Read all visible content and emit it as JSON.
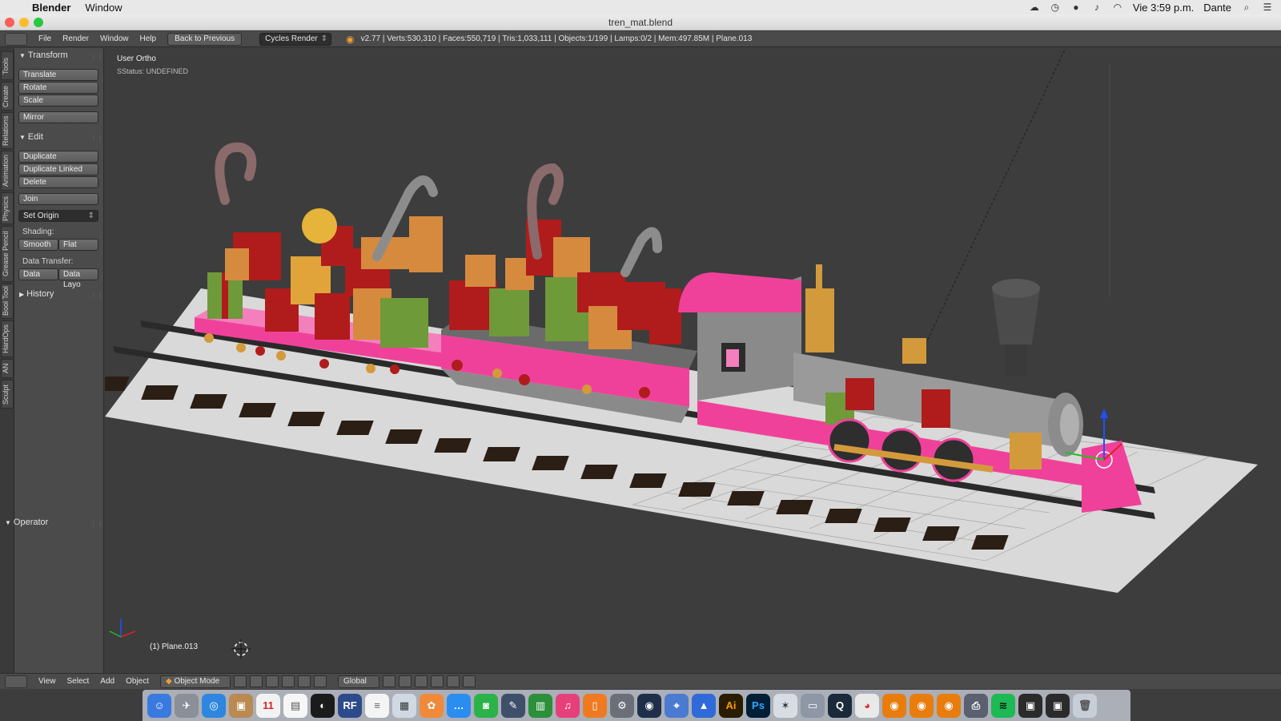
{
  "mac_menubar": {
    "app_name": "Blender",
    "menus": [
      "Window"
    ],
    "clock": "Vie 3:59 p.m.",
    "user": "Dante"
  },
  "window": {
    "title": "tren_mat.blend"
  },
  "info_header": {
    "menus": [
      "File",
      "Render",
      "Window",
      "Help"
    ],
    "back_button": "Back to Previous",
    "render_engine": "Cycles Render",
    "stats": "v2.77 | Verts:530,310 | Faces:550,719 | Tris:1,033,111 | Objects:1/199 | Lamps:0/2 | Mem:497.85M | Plane.013"
  },
  "vertical_tabs": [
    "Tools",
    "Create",
    "Relations",
    "Animation",
    "Physics",
    "Grease Pencil",
    "Bool Tool",
    "HardOps",
    "AN",
    "Sculpt"
  ],
  "toolshelf": {
    "transform": {
      "title": "Transform",
      "buttons": [
        "Translate",
        "Rotate",
        "Scale",
        "Mirror"
      ]
    },
    "edit": {
      "title": "Edit",
      "buttons": [
        "Duplicate",
        "Duplicate Linked",
        "Delete",
        "Join"
      ],
      "set_origin": "Set Origin",
      "shading_label": "Shading:",
      "smooth": "Smooth",
      "flat": "Flat",
      "data_transfer_label": "Data Transfer:",
      "data": "Data",
      "data_layout": "Data Layo"
    },
    "history": {
      "title": "History"
    },
    "operator": {
      "title": "Operator"
    }
  },
  "viewport": {
    "view_name": "User Ortho",
    "status": "SStatus: UNDEFINED",
    "active_object": "(1) Plane.013"
  },
  "view_header": {
    "menus": [
      "View",
      "Select",
      "Add",
      "Object"
    ],
    "mode": "Object Mode",
    "orientation": "Global"
  },
  "colors": {
    "pink": "#f0419a",
    "gold": "#d39a3c",
    "gift_red": "#b01c1c",
    "gift_green": "#6e9a3a",
    "gift_orange": "#d68a3e",
    "rail": "#2a2a2a",
    "sleeper": "#2b1e14",
    "ground": "#d9d9d9"
  }
}
